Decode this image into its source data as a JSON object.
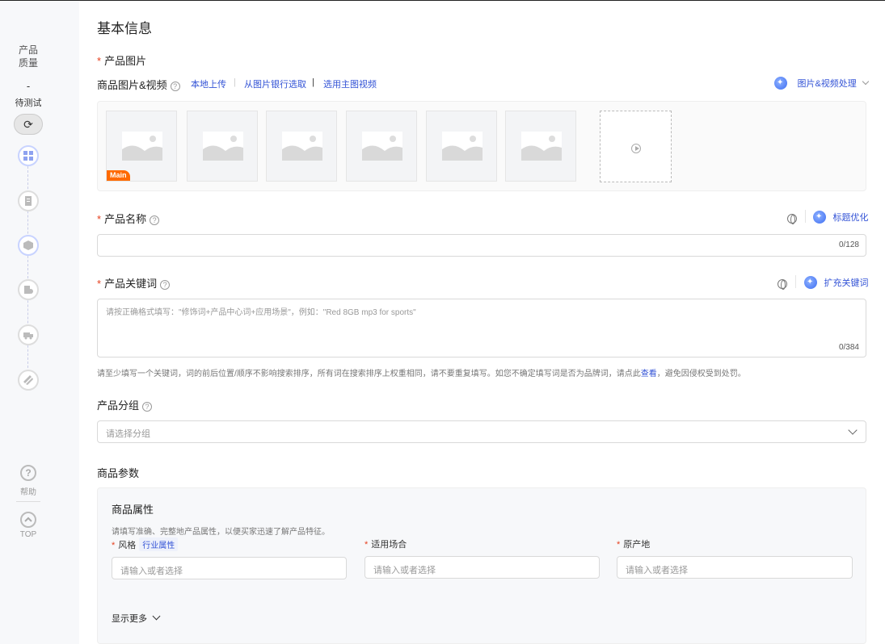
{
  "sidebar": {
    "title_line1": "产品",
    "title_line2": "质量",
    "dash": "-",
    "status": "待测试",
    "help_label": "帮助",
    "top_label": "TOP"
  },
  "page": {
    "section_title": "基本信息"
  },
  "images": {
    "label": "产品图片",
    "sub_label": "商品图片&视频",
    "link_local": "本地上传",
    "link_bank": "从图片银行选取",
    "link_separator": "|",
    "link_main_video": "选用主图视频",
    "ai_tool": "图片&视频处理",
    "main_badge": "Main"
  },
  "name_field": {
    "label": "产品名称",
    "ai_tool": "标题优化",
    "counter": "0/128",
    "value": ""
  },
  "keyword_field": {
    "label": "产品关键词",
    "ai_tool": "扩充关键词",
    "placeholder": "请按正确格式填写：\"修饰词+产品中心词+应用场景\"，例如：\"Red 8GB mp3 for sports\"",
    "counter": "0/384",
    "hint_before": "请至少填写一个关键词，词的前后位置/顺序不影响搜索排序，所有词在搜索排序上权重相同，请不要重复填写。如您不确定填写词是否为品牌词，请点此",
    "hint_link": "查看",
    "hint_after": "，避免因侵权受到处罚。"
  },
  "group_field": {
    "label": "产品分组",
    "placeholder": "请选择分组"
  },
  "params": {
    "section_title": "商品参数",
    "panel_title": "商品属性",
    "panel_desc": "请填写准确、完整地产品属性，以便买家迅速了解产品特征。",
    "fields": [
      {
        "label": "风格",
        "tag": "行业属性",
        "placeholder": "请输入或者选择"
      },
      {
        "label": "适用场合",
        "tag": "",
        "placeholder": "请输入或者选择"
      },
      {
        "label": "原产地",
        "tag": "",
        "placeholder": "请输入或者选择"
      }
    ],
    "show_more": "显示更多"
  },
  "colors": {
    "accent": "#3353d6",
    "required": "#e6401f",
    "main_badge": "#ff6a00"
  }
}
